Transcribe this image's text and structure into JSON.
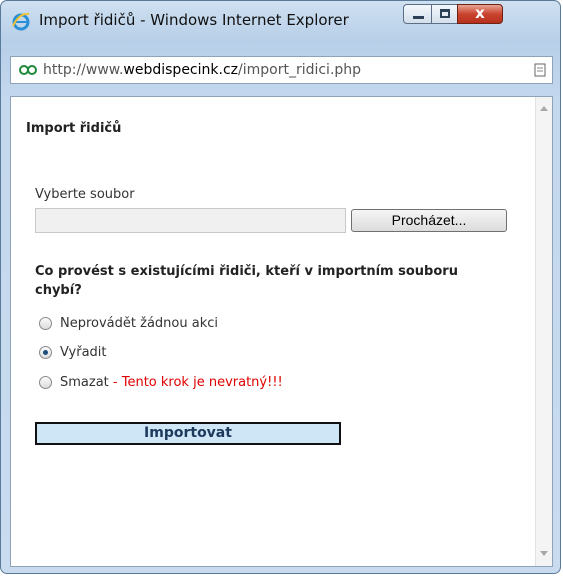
{
  "window": {
    "title": "Import řidičů - Windows Internet Explorer",
    "controls": {
      "minimize_icon": "minimize-icon",
      "maximize_icon": "maximize-icon",
      "close_glyph": "x"
    }
  },
  "address": {
    "prefix": "http://www.",
    "host": "webdispecink.cz",
    "path": "/import_ridici.php"
  },
  "form": {
    "heading": "Import řidičů",
    "file_label": "Vyberte soubor",
    "file_value": "",
    "browse_label": "Procházet...",
    "question": "Co provést s existujícími řidiči, kteří v importním souboru chybí?",
    "options": [
      {
        "label": "Neprovádět žádnou akci",
        "checked": false,
        "warning": ""
      },
      {
        "label": "Vyřadit",
        "checked": true,
        "warning": ""
      },
      {
        "label": "Smazat",
        "checked": false,
        "warning": " - Tento krok je nevratný!!!"
      }
    ],
    "submit_label": "Importovat"
  },
  "colors": {
    "warning": "#e00000",
    "submit_bg": "#cfe6f7",
    "titlebar": "#b7cfe8"
  }
}
